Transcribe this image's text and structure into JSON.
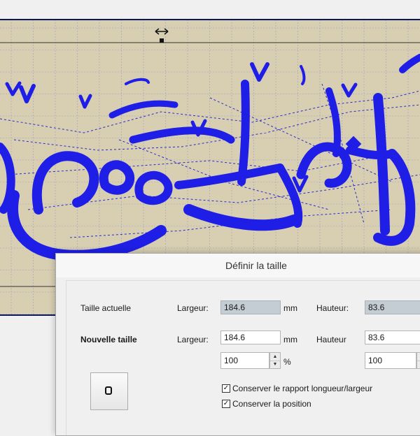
{
  "dialog": {
    "title": "Définir la taille",
    "current_size": {
      "label": "Taille actuelle",
      "width_label": "Largeur:",
      "width_value": "184.6",
      "width_unit": "mm",
      "height_label": "Hauteur:",
      "height_value": "83.6"
    },
    "new_size": {
      "label": "Nouvelle taille",
      "width_label": "Largeur:",
      "width_value": "184.6",
      "width_unit": "mm",
      "height_label": "Hauteur",
      "height_value": "83.6",
      "width_percent": "100",
      "percent_unit": "%",
      "height_percent": "100"
    },
    "options": {
      "keep_ratio": {
        "label": "Conserver le rapport longueur/largeur",
        "checked": true
      },
      "keep_position": {
        "label": "Conserver la position",
        "checked": true
      }
    }
  },
  "colors": {
    "canvas_background": "#d8cfb2",
    "grid_line": "#9a9fc0",
    "stitch_color": "#1e1ee6",
    "frame_line": "#0c1a5c",
    "readonly_field": "#c4ccd4"
  },
  "icons": {
    "resize_handle": "horizontal-resize-arrow-icon",
    "preview": "rounded-square-icon",
    "checkbox": "checkmark-icon",
    "spinner": "up-down-arrow-icon"
  }
}
